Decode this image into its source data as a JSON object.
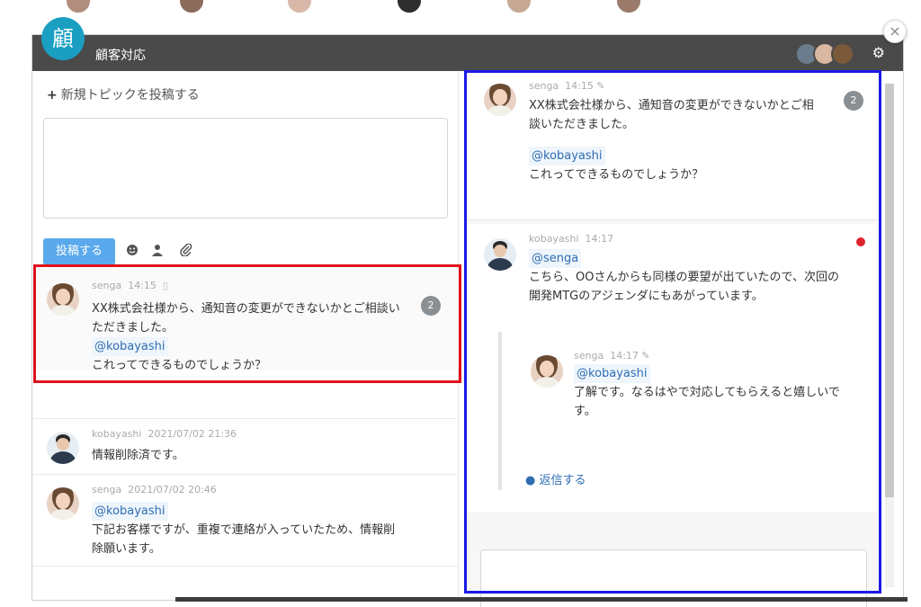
{
  "app": {
    "logo_char": "顧",
    "title": "顧客対応",
    "close_glyph": "×",
    "settings_glyph": "⚙",
    "accent_color": "#1a9fc2",
    "titlebar_color": "#4a4a4a"
  },
  "left": {
    "new_topic_label": "新規トピックを投稿する",
    "new_topic_glyph": "+",
    "post_button_label": "投稿する",
    "tools": [
      "emoji-icon",
      "user-icon",
      "attach-icon"
    ],
    "messages": [
      {
        "author": "senga",
        "time": "14:15",
        "badge": "2",
        "body_line1": "XX株式会社様から、通知音の変更ができないかとご相談い",
        "body_line2": "ただきました。",
        "mention": "@kobayashi",
        "body_line3": "これってできるものでしょうか？"
      },
      {
        "author": "kobayashi",
        "time": "2021/07/02 21:36",
        "body_line1": "情報削除済です。"
      },
      {
        "author": "senga",
        "time": "2021/07/02 20:46",
        "mention": "@kobayashi",
        "body_line1": "下記お客様ですが、重複で連絡が入っていたため、情報削",
        "body_line2": "除願います。"
      }
    ]
  },
  "right": {
    "thread": [
      {
        "author": "senga",
        "time": "14:15",
        "badge": "2",
        "body_line1": "XX株式会社様から、通知音の変更ができないかとご相",
        "body_line2": "談いただきました。",
        "mention": "@kobayashi",
        "body_line3": "これってできるものでしょうか？"
      },
      {
        "author": "kobayashi",
        "time": "14:17",
        "mention": "@senga",
        "body_line1": "こちら、OOさんからも同様の要望が出ていたので、次回の",
        "body_line2": "開発MTGのアジェンダにもあがっています。"
      },
      {
        "author": "senga",
        "time": "14:17",
        "mention": "@kobayashi",
        "body_line1": "了解です。なるはやで対応してもらえると嬉しいで",
        "body_line2": "す。"
      }
    ],
    "reply_label": "返信する"
  },
  "colors": {
    "highlight_red": "#e0101a",
    "highlight_blue": "#1a1ae6",
    "mention_blue": "#2f6db3",
    "unread_red": "#e0242f",
    "post_button": "#5aa9ec"
  }
}
